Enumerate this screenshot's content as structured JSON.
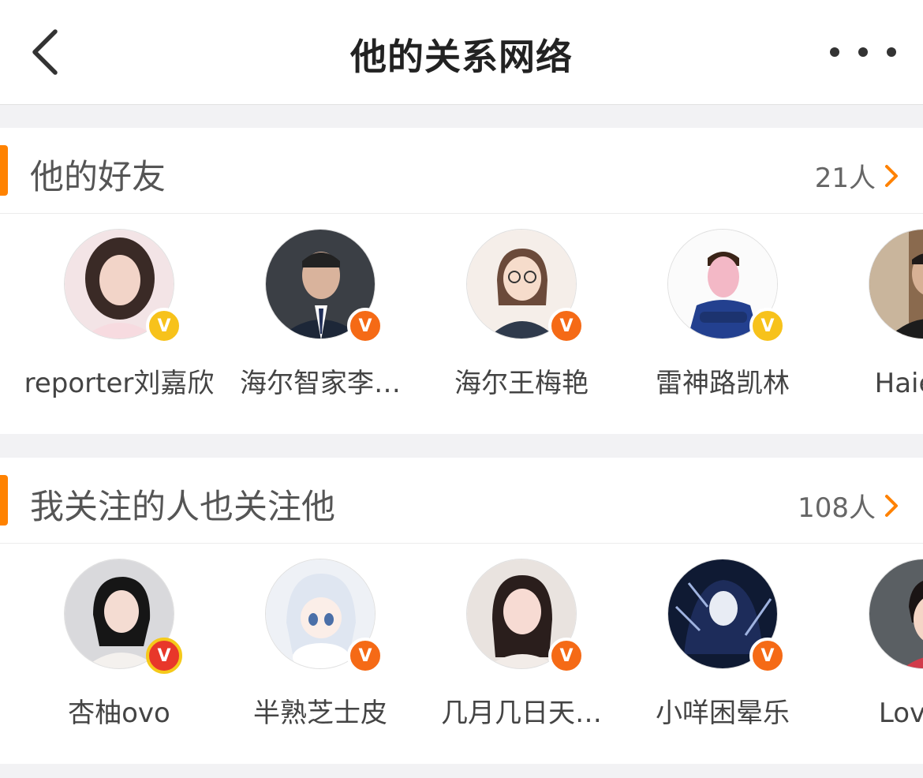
{
  "nav": {
    "title": "他的关系网络",
    "back_icon": "chevron-left-icon",
    "more_icon": "more-dots-icon"
  },
  "friends": {
    "title": "他的好友",
    "count": "21人",
    "users": [
      {
        "name": "reporter刘嘉欣",
        "badge": "gold"
      },
      {
        "name": "海尔智家李…",
        "badge": "orange"
      },
      {
        "name": "海尔王梅艳",
        "badge": "orange"
      },
      {
        "name": "雷神路凯林",
        "badge": "gold"
      },
      {
        "name": "Haier全",
        "badge": "none"
      }
    ]
  },
  "mutual": {
    "title": "我关注的人也关注他",
    "count": "108人",
    "users": [
      {
        "name": "杏柚ovo",
        "badge": "red"
      },
      {
        "name": "半熟芝士皮",
        "badge": "orange"
      },
      {
        "name": "几月几日天…",
        "badge": "orange"
      },
      {
        "name": "小咩困晕乐",
        "badge": "orange"
      },
      {
        "name": "Love雨",
        "badge": "none"
      }
    ]
  },
  "colors": {
    "accent": "#ff8200",
    "badge_gold": "#f7c21b",
    "badge_orange": "#f56a16",
    "badge_red": "#e8372a"
  }
}
